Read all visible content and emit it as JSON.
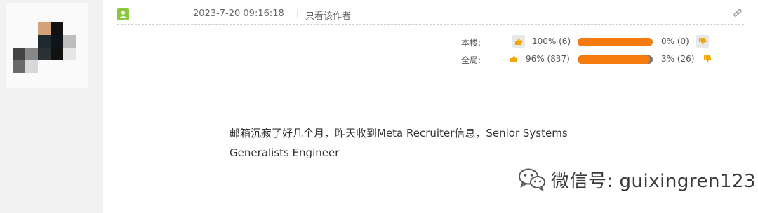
{
  "post": {
    "timestamp": "2023-7-20 09:16:18",
    "separator": "|",
    "author_only_label": "只看该作者",
    "content_line1": "邮箱沉寂了好几个月，昨天收到Meta Recruiter信息，Senior Systems",
    "content_line2": "Generalists Engineer"
  },
  "ratings": {
    "floor": {
      "label": "本楼:",
      "up_text": "100% (6)",
      "up_fraction": 1.0,
      "down_text": "0% (0)"
    },
    "overall": {
      "label": "全局:",
      "up_text": "96% (837)",
      "up_fraction": 0.96,
      "down_text": "3% (26)"
    }
  },
  "watermark": {
    "text": "微信号: guixingren123"
  },
  "colors": {
    "bar_fill": "#f57b0f",
    "bar_track": "#777777",
    "online_icon": "#8cc63f",
    "thumb": "#f0a500"
  },
  "icons": [
    "online-status-icon",
    "link-icon",
    "thumb-up-icon",
    "thumb-down-icon",
    "wechat-logo-icon"
  ]
}
